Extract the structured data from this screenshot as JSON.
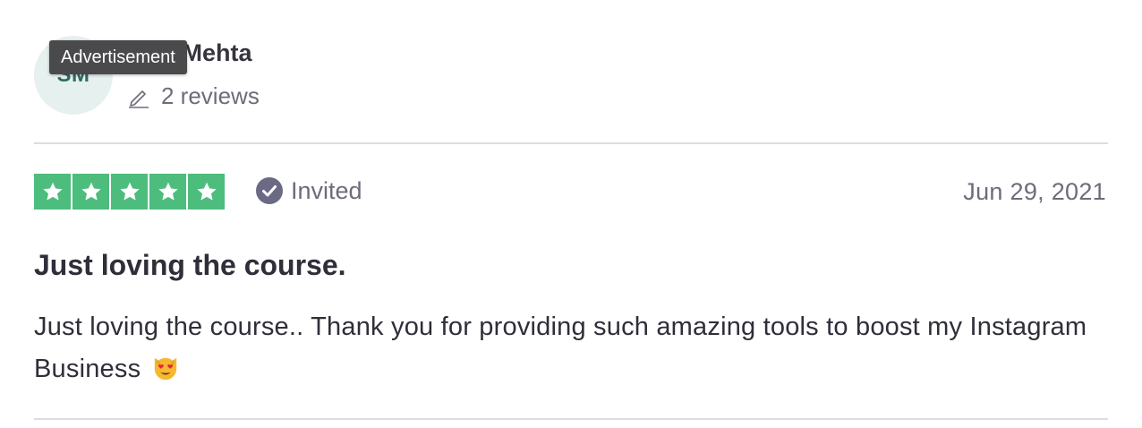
{
  "reviewer": {
    "initials": "SM",
    "name": "eyjit Mehta",
    "review_count": "2 reviews"
  },
  "tooltip": {
    "label": "Advertisement"
  },
  "review": {
    "rating": 5,
    "rating_max": 5,
    "invited_label": "Invited",
    "date": "Jun 29, 2021",
    "title": "Just loving the course.",
    "body": "Just loving the course.. Thank you for providing such amazing tools to boost my Instagram Business",
    "body_emoji": "heart-eyes-cat-icon"
  },
  "colors": {
    "star_fill": "#4dbd7d",
    "verified_badge": "#6b6a84",
    "avatar_bg": "#e6f0ee",
    "tooltip_bg": "#4a4a4c"
  }
}
